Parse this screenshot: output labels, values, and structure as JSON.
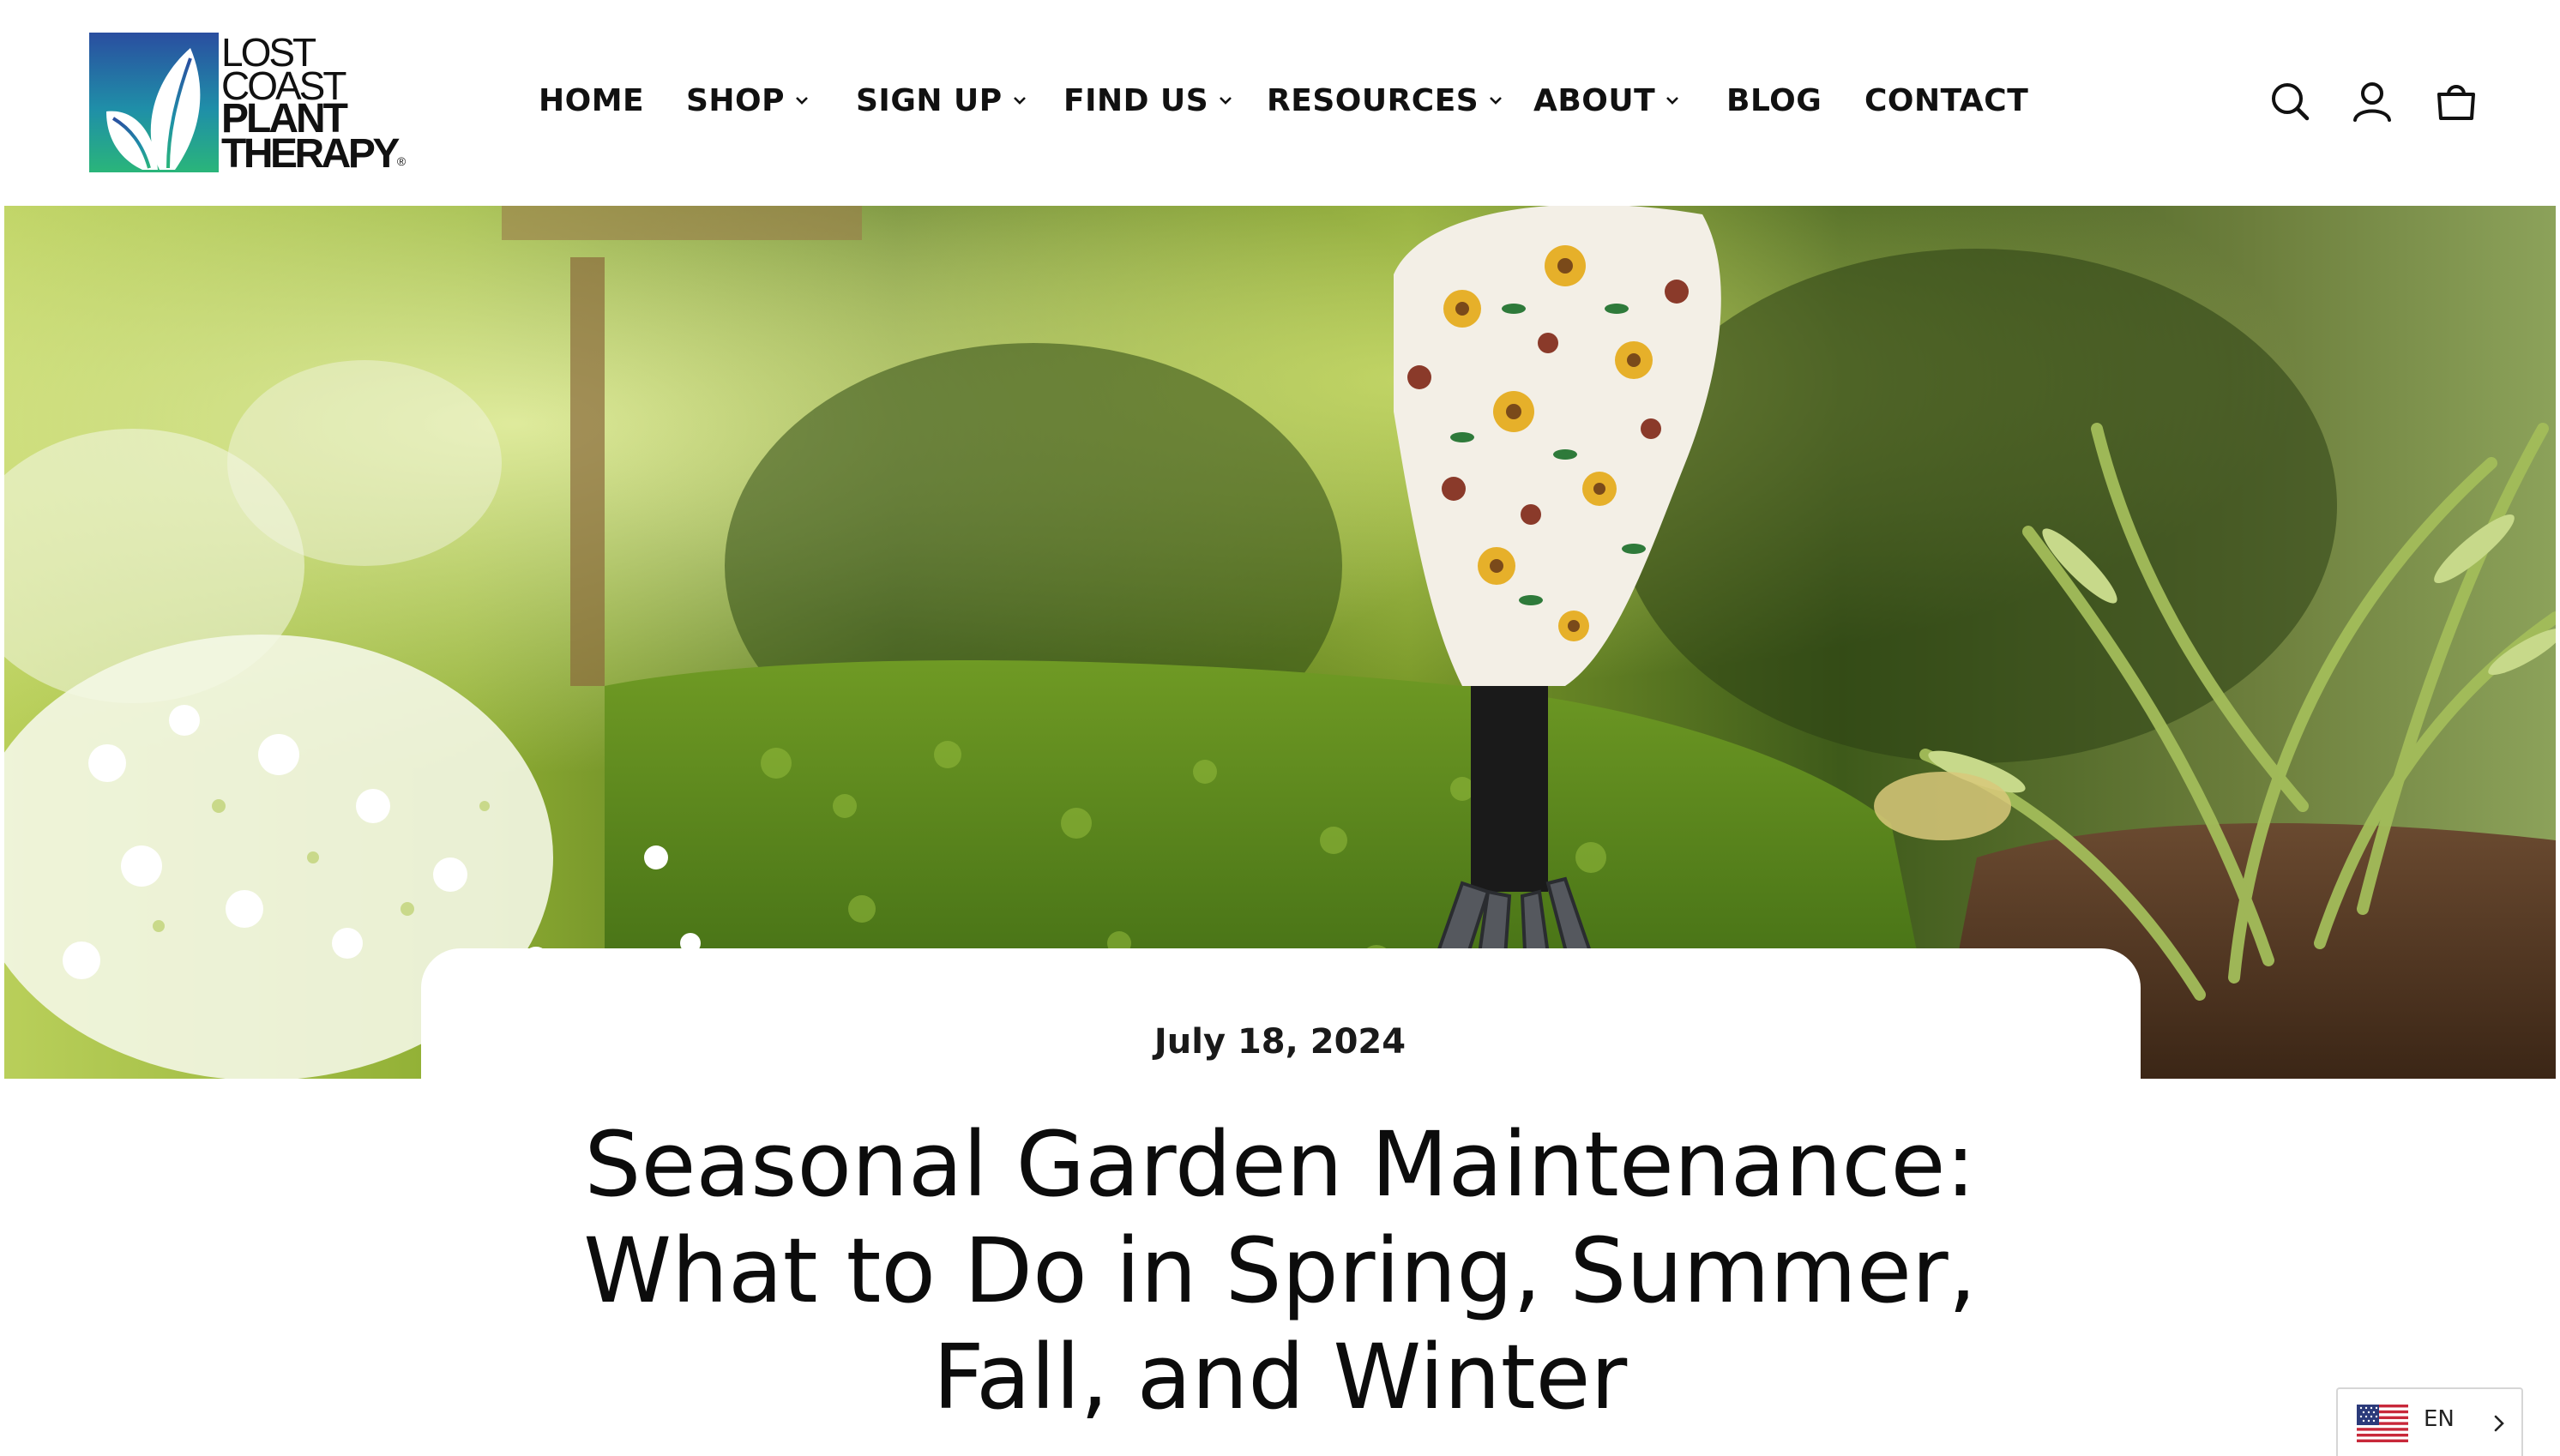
{
  "header": {
    "logo": {
      "line1": "LOST",
      "line2": "COAST",
      "line3": "PLANT",
      "line4": "THERAPY",
      "registered": "®"
    },
    "nav": [
      {
        "label": "HOME",
        "has_dropdown": false
      },
      {
        "label": "SHOP",
        "has_dropdown": true
      },
      {
        "label": "SIGN UP",
        "has_dropdown": true
      },
      {
        "label": "FIND US",
        "has_dropdown": true
      },
      {
        "label": "RESOURCES",
        "has_dropdown": true
      },
      {
        "label": "ABOUT",
        "has_dropdown": true
      },
      {
        "label": "BLOG",
        "has_dropdown": false
      },
      {
        "label": "CONTACT",
        "has_dropdown": false
      }
    ],
    "icons": [
      "search-icon",
      "account-icon",
      "cart-icon"
    ]
  },
  "article": {
    "date": "July 18, 2024",
    "title_lines": [
      "Seasonal Garden Maintenance:",
      "What to Do in Spring, Summer,",
      "Fall, and Winter"
    ]
  },
  "language": {
    "code": "EN",
    "flag": "us-flag-icon"
  },
  "colors": {
    "logo_gradient_top": "#2a4ea0",
    "logo_gradient_bottom": "#2ab57a",
    "text": "#111111"
  }
}
